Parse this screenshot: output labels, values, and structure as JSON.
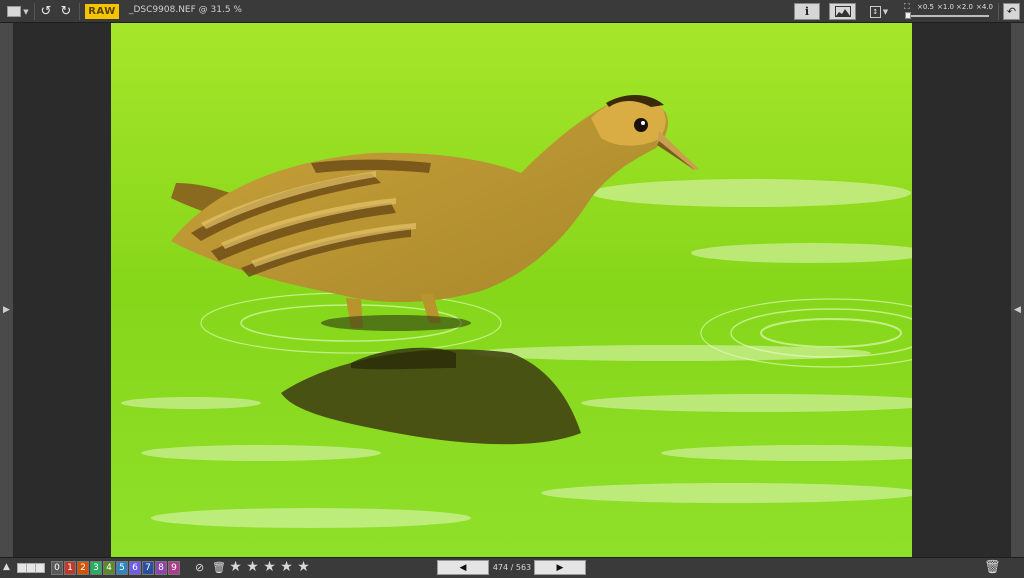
{
  "toolbar": {
    "display_mode_icon": "display-mode-icon",
    "rotate_left_icon": "rotate-left-icon",
    "rotate_right_icon": "rotate-right-icon",
    "raw_badge": "RAW",
    "file_title": "_DSC9908.NEF @ 31.5 %",
    "info_label": "i",
    "histogram_icon": "histogram-icon",
    "fit_icon": "fit-to-screen-icon",
    "zoom_options": [
      "×0.5",
      "×1.0",
      "×2.0",
      "×4.0"
    ],
    "undo_icon": "undo-icon"
  },
  "bottombar": {
    "labels": [
      "0",
      "1",
      "2",
      "3",
      "4",
      "5",
      "6",
      "7",
      "8",
      "9"
    ],
    "label_colors": [
      "#5a5a5a",
      "#c0392b",
      "#d35400",
      "#27ae60",
      "#5a8a2a",
      "#2e86c1",
      "#6c5ce7",
      "#2a4fa0",
      "#8e44ad",
      "#b03a8c"
    ],
    "rating_max": 5,
    "rating_value": 0,
    "counter": "474 / 563",
    "prev_icon": "prev-arrow-icon",
    "next_icon": "next-arrow-icon",
    "trash_icon": "trash-icon"
  },
  "colors": {
    "raw_badge_bg": "#f5c400",
    "toolbar_bg": "#3a3a3a",
    "water_green": "#8fe01a"
  }
}
